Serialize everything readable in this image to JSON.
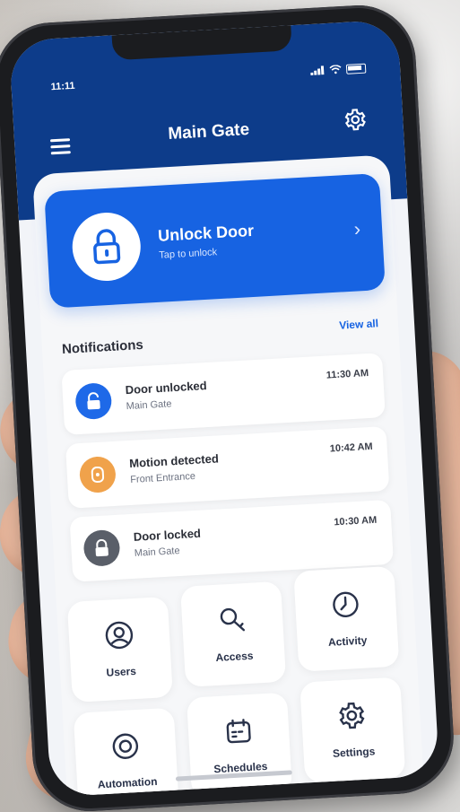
{
  "status": {
    "time": "11:11"
  },
  "header": {
    "title": "Main Gate"
  },
  "unlock": {
    "title": "Unlock Door",
    "subtitle": "Tap to unlock"
  },
  "notifications": {
    "title": "Notifications",
    "view_all": "View all",
    "items": [
      {
        "title": "Door unlocked",
        "subtitle": "Main Gate",
        "time": "11:30 AM",
        "icon": "lock-open-icon",
        "color": "#1e69e8"
      },
      {
        "title": "Motion detected",
        "subtitle": "Front Entrance",
        "time": "10:42 AM",
        "icon": "motion-icon",
        "color": "#f0a24b"
      },
      {
        "title": "Door locked",
        "subtitle": "Main Gate",
        "time": "10:30 AM",
        "icon": "lock-icon",
        "color": "#5a5f69"
      }
    ]
  },
  "grid": {
    "items": [
      {
        "label": "Users",
        "icon": "user-icon"
      },
      {
        "label": "Access",
        "icon": "key-icon"
      },
      {
        "label": "Activity",
        "icon": "activity-icon"
      },
      {
        "label": "Automation",
        "icon": "automation-icon"
      },
      {
        "label": "Schedules",
        "icon": "calendar-icon"
      },
      {
        "label": "Settings",
        "icon": "gear-icon"
      }
    ]
  },
  "colors": {
    "header_bg": "#0d3c8a",
    "accent": "#1763e2"
  }
}
